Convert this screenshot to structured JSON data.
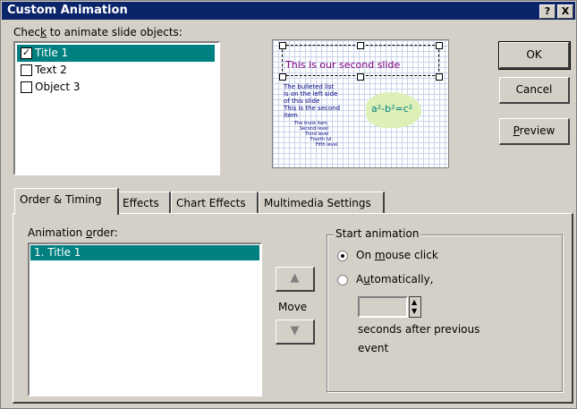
{
  "window": {
    "title": "Custom Animation",
    "help_label": "?",
    "close_label": "X"
  },
  "check_list": {
    "label_before": "Chec",
    "label_key": "k",
    "label_after": " to animate slide objects:",
    "items": [
      {
        "label": "Title 1",
        "checked": true,
        "check_mark": "✓"
      },
      {
        "label": "Text 2",
        "checked": false,
        "check_mark": ""
      },
      {
        "label": "Object 3",
        "checked": false,
        "check_mark": ""
      }
    ]
  },
  "slide_preview": {
    "title": "This is our second slide",
    "bullets": [
      "The bulleted list",
      "is on the left side",
      "of this slide",
      "This is the second",
      "item"
    ],
    "sub_bullets": [
      "The trunk item",
      "Second level",
      "Third level",
      "Fourth lvl",
      "Fifth level"
    ],
    "formula": "a²-b²=c²"
  },
  "buttons": {
    "ok": "OK",
    "cancel": "Cancel",
    "preview_key": "P",
    "preview_rest": "review"
  },
  "tabs": [
    {
      "label": "Order & Timing",
      "active": true
    },
    {
      "label": "Effects",
      "active": false
    },
    {
      "label": "Chart Effects",
      "active": false
    },
    {
      "label": "Multimedia Settings",
      "active": false
    }
  ],
  "order": {
    "label_before": "Animation ",
    "label_key": "o",
    "label_after": "rder:",
    "items": [
      "1. Title 1"
    ],
    "move_label": "Move",
    "up_icon": "▲",
    "down_icon": "▼"
  },
  "start": {
    "group_label": "Start animation",
    "on_click_before": "On ",
    "on_click_key": "m",
    "on_click_after": "ouse click",
    "auto_before": "A",
    "auto_key": "u",
    "auto_after": "tomatically,",
    "seconds_value": "",
    "seconds_label_1": "seconds after previous",
    "seconds_label_2": "event",
    "selected": "on_mouse_click"
  },
  "colors": {
    "titlebar": "#0a246a",
    "selection": "#008080",
    "face": "#d4d0c8"
  }
}
